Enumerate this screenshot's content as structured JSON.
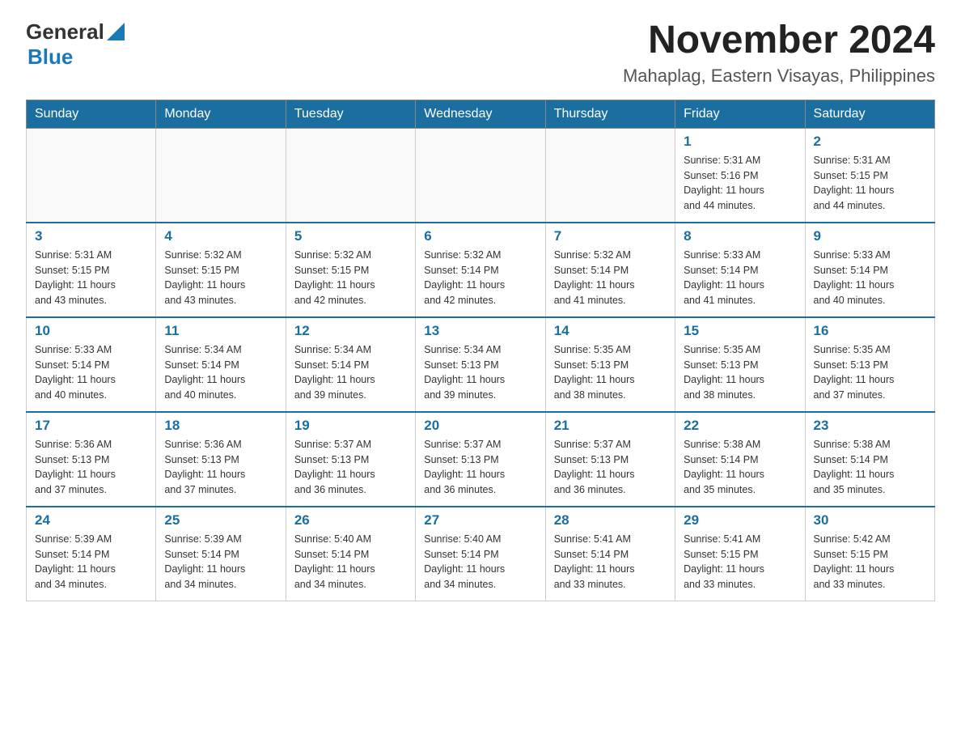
{
  "header": {
    "logo_line1": "General",
    "logo_line2": "Blue",
    "month_title": "November 2024",
    "location": "Mahaplag, Eastern Visayas, Philippines"
  },
  "days_of_week": [
    "Sunday",
    "Monday",
    "Tuesday",
    "Wednesday",
    "Thursday",
    "Friday",
    "Saturday"
  ],
  "weeks": [
    [
      {
        "day": "",
        "info": ""
      },
      {
        "day": "",
        "info": ""
      },
      {
        "day": "",
        "info": ""
      },
      {
        "day": "",
        "info": ""
      },
      {
        "day": "",
        "info": ""
      },
      {
        "day": "1",
        "info": "Sunrise: 5:31 AM\nSunset: 5:16 PM\nDaylight: 11 hours\nand 44 minutes."
      },
      {
        "day": "2",
        "info": "Sunrise: 5:31 AM\nSunset: 5:15 PM\nDaylight: 11 hours\nand 44 minutes."
      }
    ],
    [
      {
        "day": "3",
        "info": "Sunrise: 5:31 AM\nSunset: 5:15 PM\nDaylight: 11 hours\nand 43 minutes."
      },
      {
        "day": "4",
        "info": "Sunrise: 5:32 AM\nSunset: 5:15 PM\nDaylight: 11 hours\nand 43 minutes."
      },
      {
        "day": "5",
        "info": "Sunrise: 5:32 AM\nSunset: 5:15 PM\nDaylight: 11 hours\nand 42 minutes."
      },
      {
        "day": "6",
        "info": "Sunrise: 5:32 AM\nSunset: 5:14 PM\nDaylight: 11 hours\nand 42 minutes."
      },
      {
        "day": "7",
        "info": "Sunrise: 5:32 AM\nSunset: 5:14 PM\nDaylight: 11 hours\nand 41 minutes."
      },
      {
        "day": "8",
        "info": "Sunrise: 5:33 AM\nSunset: 5:14 PM\nDaylight: 11 hours\nand 41 minutes."
      },
      {
        "day": "9",
        "info": "Sunrise: 5:33 AM\nSunset: 5:14 PM\nDaylight: 11 hours\nand 40 minutes."
      }
    ],
    [
      {
        "day": "10",
        "info": "Sunrise: 5:33 AM\nSunset: 5:14 PM\nDaylight: 11 hours\nand 40 minutes."
      },
      {
        "day": "11",
        "info": "Sunrise: 5:34 AM\nSunset: 5:14 PM\nDaylight: 11 hours\nand 40 minutes."
      },
      {
        "day": "12",
        "info": "Sunrise: 5:34 AM\nSunset: 5:14 PM\nDaylight: 11 hours\nand 39 minutes."
      },
      {
        "day": "13",
        "info": "Sunrise: 5:34 AM\nSunset: 5:13 PM\nDaylight: 11 hours\nand 39 minutes."
      },
      {
        "day": "14",
        "info": "Sunrise: 5:35 AM\nSunset: 5:13 PM\nDaylight: 11 hours\nand 38 minutes."
      },
      {
        "day": "15",
        "info": "Sunrise: 5:35 AM\nSunset: 5:13 PM\nDaylight: 11 hours\nand 38 minutes."
      },
      {
        "day": "16",
        "info": "Sunrise: 5:35 AM\nSunset: 5:13 PM\nDaylight: 11 hours\nand 37 minutes."
      }
    ],
    [
      {
        "day": "17",
        "info": "Sunrise: 5:36 AM\nSunset: 5:13 PM\nDaylight: 11 hours\nand 37 minutes."
      },
      {
        "day": "18",
        "info": "Sunrise: 5:36 AM\nSunset: 5:13 PM\nDaylight: 11 hours\nand 37 minutes."
      },
      {
        "day": "19",
        "info": "Sunrise: 5:37 AM\nSunset: 5:13 PM\nDaylight: 11 hours\nand 36 minutes."
      },
      {
        "day": "20",
        "info": "Sunrise: 5:37 AM\nSunset: 5:13 PM\nDaylight: 11 hours\nand 36 minutes."
      },
      {
        "day": "21",
        "info": "Sunrise: 5:37 AM\nSunset: 5:13 PM\nDaylight: 11 hours\nand 36 minutes."
      },
      {
        "day": "22",
        "info": "Sunrise: 5:38 AM\nSunset: 5:14 PM\nDaylight: 11 hours\nand 35 minutes."
      },
      {
        "day": "23",
        "info": "Sunrise: 5:38 AM\nSunset: 5:14 PM\nDaylight: 11 hours\nand 35 minutes."
      }
    ],
    [
      {
        "day": "24",
        "info": "Sunrise: 5:39 AM\nSunset: 5:14 PM\nDaylight: 11 hours\nand 34 minutes."
      },
      {
        "day": "25",
        "info": "Sunrise: 5:39 AM\nSunset: 5:14 PM\nDaylight: 11 hours\nand 34 minutes."
      },
      {
        "day": "26",
        "info": "Sunrise: 5:40 AM\nSunset: 5:14 PM\nDaylight: 11 hours\nand 34 minutes."
      },
      {
        "day": "27",
        "info": "Sunrise: 5:40 AM\nSunset: 5:14 PM\nDaylight: 11 hours\nand 34 minutes."
      },
      {
        "day": "28",
        "info": "Sunrise: 5:41 AM\nSunset: 5:14 PM\nDaylight: 11 hours\nand 33 minutes."
      },
      {
        "day": "29",
        "info": "Sunrise: 5:41 AM\nSunset: 5:15 PM\nDaylight: 11 hours\nand 33 minutes."
      },
      {
        "day": "30",
        "info": "Sunrise: 5:42 AM\nSunset: 5:15 PM\nDaylight: 11 hours\nand 33 minutes."
      }
    ]
  ]
}
